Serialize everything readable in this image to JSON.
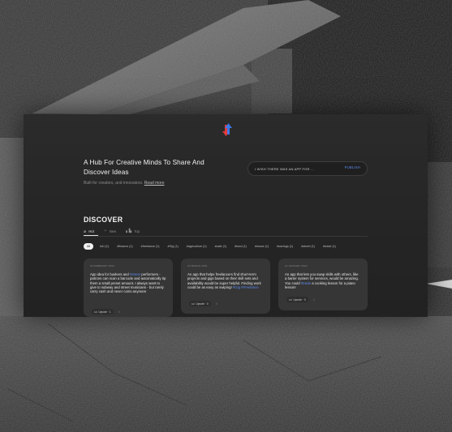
{
  "app": {
    "hero": {
      "title": "A Hub For Creative Minds To Share And Discover Ideas",
      "subtitle": "Built for creators, and innovators.",
      "read_more": "Read more"
    },
    "publish": {
      "placeholder": "I WISH THERE WAS AN APP FOR ...",
      "button_label": "PUBLISH"
    },
    "discover": {
      "heading": "DISCOVER",
      "tabs": [
        {
          "label": "Hot",
          "icon": "flame-icon",
          "active": true
        },
        {
          "label": "New",
          "icon": "sparkle-icon",
          "active": false
        },
        {
          "label": "Top",
          "icon": "bar-chart-icon",
          "active": false
        }
      ],
      "chips": [
        "All",
        "#AI (1)",
        "#finance (1)",
        "#freelance (1)",
        "#Gig (1)",
        "#agriculture (1)",
        "#cafe (1)",
        "#food (1)",
        "#music (1)",
        "#savings (1)",
        "#street (1)",
        "#trade (1)"
      ]
    },
    "cards": [
      {
        "date": "03 FEBRUARY 2024",
        "parts": [
          {
            "t": "App idea for buskers and "
          },
          {
            "t": "#street",
            "tag": true
          },
          {
            "t": " performers - patrons can scan a barcode and automatically tip them a small preset amount. I always want to give to subway and street musicians - but rarely carry cash and never coins anymore"
          }
        ],
        "upvotes": "Upvote · 1",
        "comment_icon": "comment-icon"
      },
      {
        "date": "23 MARCH 2024",
        "parts": [
          {
            "t": "An app that helps freelancers find short-term projects and gigs based on their skill sets and availability would be super helpful. Finding work could be as easy as swiping! "
          },
          {
            "t": "#Gig #Freelance",
            "tag": true
          }
        ],
        "upvotes": "Upvote · 0",
        "comment_icon": "comment-icon"
      },
      {
        "date": "21 JANUARY 2024",
        "parts": [
          {
            "t": "An app that lets you swap skills with others, like a barter system for services, would be amazing. You could "
          },
          {
            "t": "#trade",
            "tag": true
          },
          {
            "t": " a cooking lesson for a piano lesson!"
          }
        ],
        "upvotes": "Upvote · 0",
        "comment_icon": "comment-icon"
      }
    ]
  }
}
